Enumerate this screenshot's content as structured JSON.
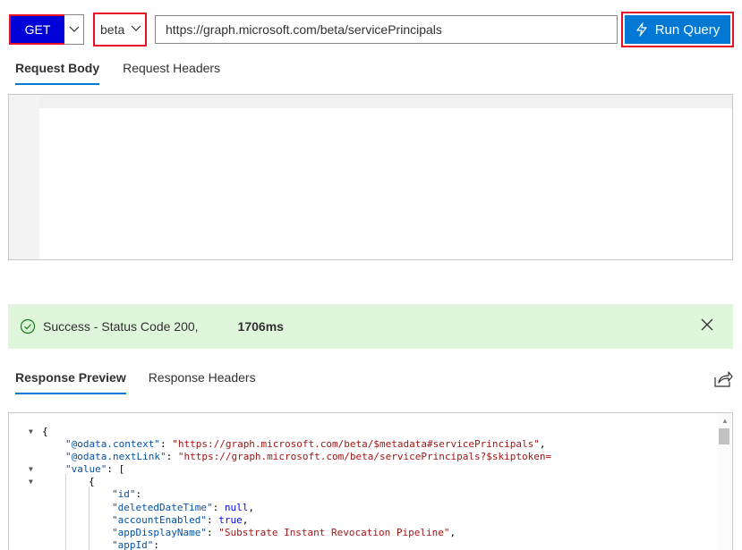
{
  "toolbar": {
    "method": "GET",
    "version": "beta",
    "url": "https://graph.microsoft.com/beta/servicePrincipals",
    "run_label": "Run Query"
  },
  "request_tabs": [
    "Request Body",
    "Request Headers"
  ],
  "status": {
    "text": "Success - Status Code 200,",
    "duration": "1706ms"
  },
  "response_tabs": [
    "Response Preview",
    "Response Headers"
  ],
  "response_lines": [
    {
      "indent": 0,
      "fold": true,
      "tokens": [
        [
          "p",
          "{"
        ]
      ]
    },
    {
      "indent": 1,
      "fold": false,
      "tokens": [
        [
          "k",
          "\"@odata.context\""
        ],
        [
          "p",
          ": "
        ],
        [
          "s",
          "\"https://graph.microsoft.com/beta/$metadata#servicePrincipals\""
        ],
        [
          "p",
          ","
        ]
      ]
    },
    {
      "indent": 1,
      "fold": false,
      "tokens": [
        [
          "k",
          "\"@odata.nextLink\""
        ],
        [
          "p",
          ": "
        ],
        [
          "s",
          "\"https://graph.microsoft.com/beta/servicePrincipals?$skiptoken="
        ]
      ]
    },
    {
      "indent": 1,
      "fold": true,
      "tokens": [
        [
          "k",
          "\"value\""
        ],
        [
          "p",
          ": ["
        ]
      ]
    },
    {
      "indent": 2,
      "fold": true,
      "tokens": [
        [
          "p",
          "{"
        ]
      ]
    },
    {
      "indent": 3,
      "fold": false,
      "tokens": [
        [
          "k",
          "\"id\""
        ],
        [
          "p",
          ":"
        ]
      ]
    },
    {
      "indent": 3,
      "fold": false,
      "tokens": [
        [
          "k",
          "\"deletedDateTime\""
        ],
        [
          "p",
          ": "
        ],
        [
          "kw",
          "null"
        ],
        [
          "p",
          ","
        ]
      ]
    },
    {
      "indent": 3,
      "fold": false,
      "tokens": [
        [
          "k",
          "\"accountEnabled\""
        ],
        [
          "p",
          ": "
        ],
        [
          "kw",
          "true"
        ],
        [
          "p",
          ","
        ]
      ]
    },
    {
      "indent": 3,
      "fold": false,
      "tokens": [
        [
          "k",
          "\"appDisplayName\""
        ],
        [
          "p",
          ": "
        ],
        [
          "s",
          "\"Substrate Instant Revocation Pipeline\""
        ],
        [
          "p",
          ","
        ]
      ]
    },
    {
      "indent": 3,
      "fold": false,
      "tokens": [
        [
          "k",
          "\"appId\""
        ],
        [
          "p",
          ":"
        ]
      ]
    }
  ]
}
